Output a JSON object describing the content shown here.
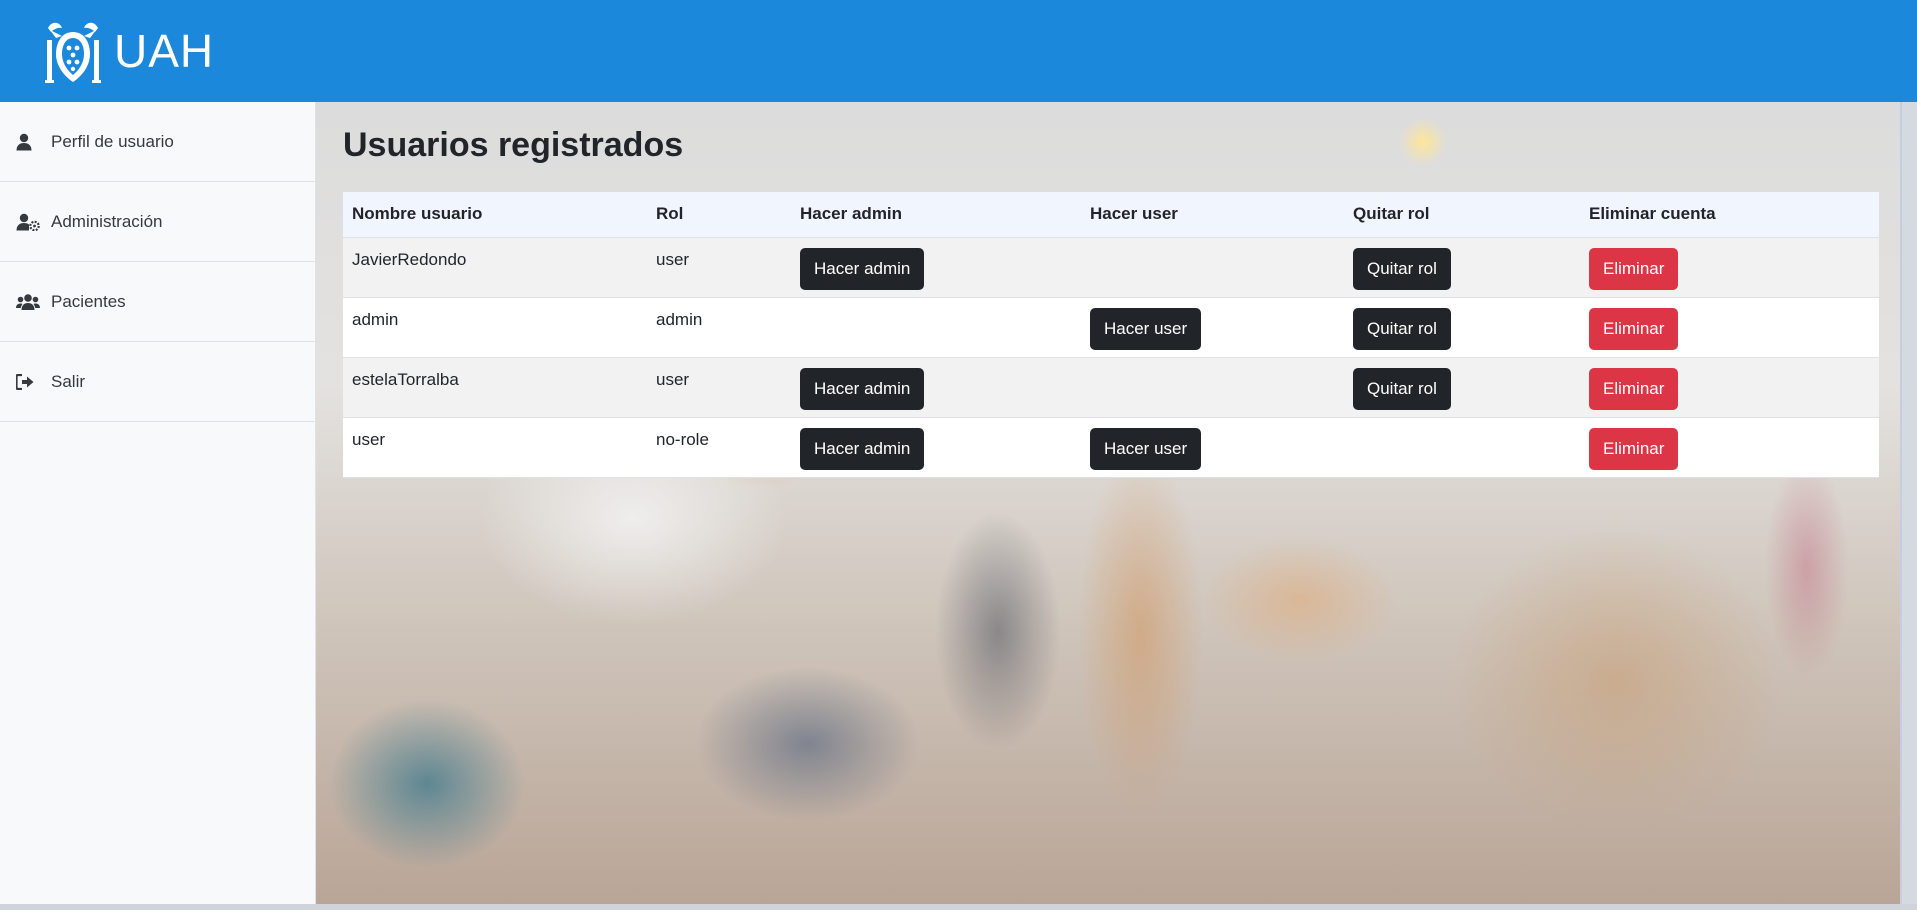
{
  "header": {
    "logo_text": "UAH",
    "background_color": "#1c88db",
    "logo_icon": "university-crest-icon"
  },
  "sidebar": {
    "items": [
      {
        "label": "Perfil de usuario",
        "icon": "user-icon"
      },
      {
        "label": "Administración",
        "icon": "user-cog-icon"
      },
      {
        "label": "Pacientes",
        "icon": "users-icon"
      },
      {
        "label": "Salir",
        "icon": "sign-out-icon"
      }
    ]
  },
  "main": {
    "title": "Usuarios registrados",
    "table": {
      "headers": [
        "Nombre usuario",
        "Rol",
        "Hacer admin",
        "Hacer user",
        "Quitar rol",
        "Eliminar cuenta"
      ],
      "rows": [
        {
          "username": "JavierRedondo",
          "role": "user",
          "make_admin": "Hacer admin",
          "make_user": "",
          "remove_role": "Quitar rol",
          "delete": "Eliminar"
        },
        {
          "username": "admin",
          "role": "admin",
          "make_admin": "",
          "make_user": "Hacer user",
          "remove_role": "Quitar rol",
          "delete": "Eliminar"
        },
        {
          "username": "estelaTorralba",
          "role": "user",
          "make_admin": "Hacer admin",
          "make_user": "",
          "remove_role": "Quitar rol",
          "delete": "Eliminar"
        },
        {
          "username": "user",
          "role": "no-role",
          "make_admin": "Hacer admin",
          "make_user": "Hacer user",
          "remove_role": "",
          "delete": "Eliminar"
        }
      ]
    }
  },
  "colors": {
    "accent": "#1c88db",
    "button_dark": "#212529",
    "button_danger": "#dc3545"
  }
}
